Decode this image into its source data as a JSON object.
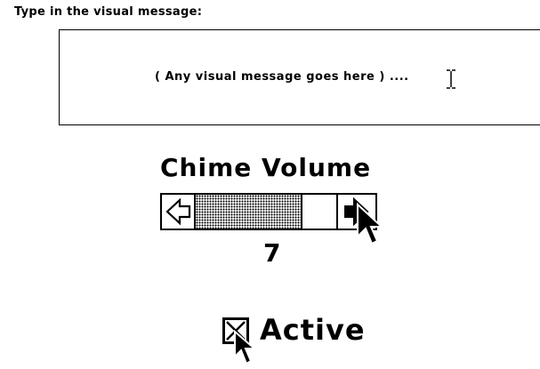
{
  "prompt": {
    "label": "Type in the visual message:"
  },
  "message": {
    "text": "( Any visual message goes here ) ....",
    "cursor_icon": "ibeam-cursor-icon"
  },
  "volume": {
    "title": "Chime Volume",
    "value": "7",
    "scrollbar": {
      "left_arrow_icon": "arrow-left-icon",
      "right_arrow_icon": "arrow-right-icon",
      "thumb_position_fraction": 0.7
    },
    "pointer_icon": "arrow-pointer-icon"
  },
  "active": {
    "label": "Active",
    "checked": true,
    "checkbox_icon": "x-checkbox-icon",
    "pointer_icon": "arrow-pointer-icon"
  }
}
